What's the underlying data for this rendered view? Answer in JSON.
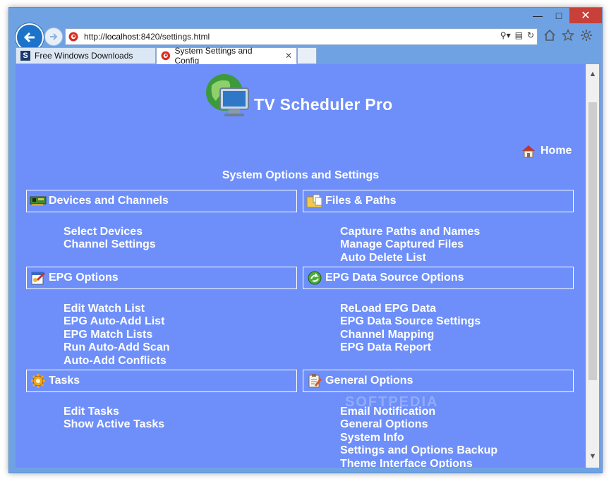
{
  "browser": {
    "address": {
      "scheme": "http://",
      "host": "localhost",
      "rest": ":8420/settings.html"
    },
    "tabs": [
      {
        "label": "Free Windows Downloads",
        "active": false
      },
      {
        "label": "System Settings and Config",
        "active": true
      }
    ]
  },
  "app": {
    "title": "TV Scheduler Pro"
  },
  "nav": {
    "home_label": "Home"
  },
  "page": {
    "heading": "System Options and Settings"
  },
  "panels": [
    {
      "title": "Devices and Channels",
      "icon": "network-card-icon",
      "links": [
        "Select Devices",
        "Channel Settings"
      ]
    },
    {
      "title": "Files & Paths",
      "icon": "folder-files-icon",
      "links": [
        "Capture Paths and Names",
        "Manage Captured Files",
        "Auto Delete List"
      ]
    },
    {
      "title": "EPG Options",
      "icon": "epg-options-icon",
      "links": [
        "Edit Watch List",
        "EPG Auto-Add List",
        "EPG Match Lists",
        "Run Auto-Add Scan",
        "Auto-Add Conflicts"
      ]
    },
    {
      "title": "EPG Data Source Options",
      "icon": "data-source-icon",
      "links": [
        "ReLoad EPG Data",
        "EPG Data Source Settings",
        "Channel Mapping",
        "EPG Data Report"
      ]
    },
    {
      "title": "Tasks",
      "icon": "gear-icon",
      "links": [
        "Edit Tasks",
        "Show Active Tasks"
      ]
    },
    {
      "title": "General Options",
      "icon": "clipboard-pencil-icon",
      "links": [
        "Email Notification",
        "General Options",
        "System Info",
        "Settings and Options Backup",
        "Theme Interface Options"
      ]
    }
  ],
  "watermark": "SOFTPEDIA",
  "colors": {
    "page_bg": "#6e8ffa",
    "window_frame": "#6fa2e3",
    "close_button": "#c7403a"
  }
}
